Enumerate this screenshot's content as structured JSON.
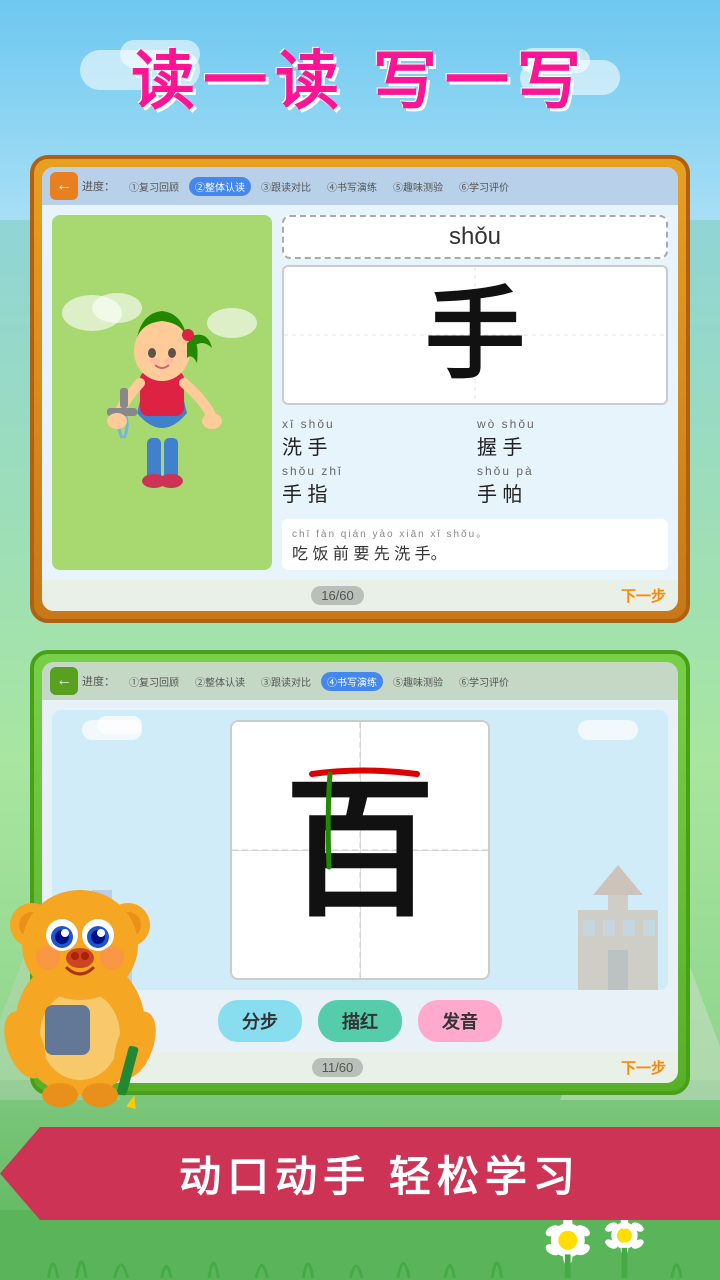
{
  "title": "读一读 写一写",
  "card1": {
    "progress_label": "进度：",
    "steps": [
      {
        "label": "①复习回顾",
        "active": false
      },
      {
        "label": "②整体认读",
        "active": true
      },
      {
        "label": "③跟读对比",
        "active": false
      },
      {
        "label": "④书写演练",
        "active": false
      },
      {
        "label": "⑤趣味测验",
        "active": false
      },
      {
        "label": "⑥学习评价",
        "active": false
      }
    ],
    "pinyin": "shǒu",
    "character": "手",
    "words": [
      {
        "pinyin": "xī  shǒu",
        "chars": "洗 手"
      },
      {
        "pinyin": "wò  shǒu",
        "chars": "握 手"
      },
      {
        "pinyin": "shǒu  zhǐ",
        "chars": "手 指"
      },
      {
        "pinyin": "shǒu  pà",
        "chars": "手 帕"
      }
    ],
    "sentence_pinyin": "chī  fàn  qián  yào  xiān  xǐ  shǒu。",
    "sentence_text": "吃 饭 前 要 先 洗 手。",
    "page": "16/60",
    "next_label": "下一步"
  },
  "card2": {
    "progress_label": "进度：",
    "steps": [
      {
        "label": "①复习回顾",
        "active": false
      },
      {
        "label": "②整体认读",
        "active": false
      },
      {
        "label": "③跟读对比",
        "active": false
      },
      {
        "label": "④书写演练",
        "active": true
      },
      {
        "label": "⑤趣味测验",
        "active": false
      },
      {
        "label": "⑥学习评价",
        "active": false
      }
    ],
    "character": "百",
    "btn1": "分步",
    "btn2": "描红",
    "btn3": "发音",
    "page": "11/60",
    "next_label": "下一步"
  },
  "bottom_banner": "动口动手 轻松学习"
}
